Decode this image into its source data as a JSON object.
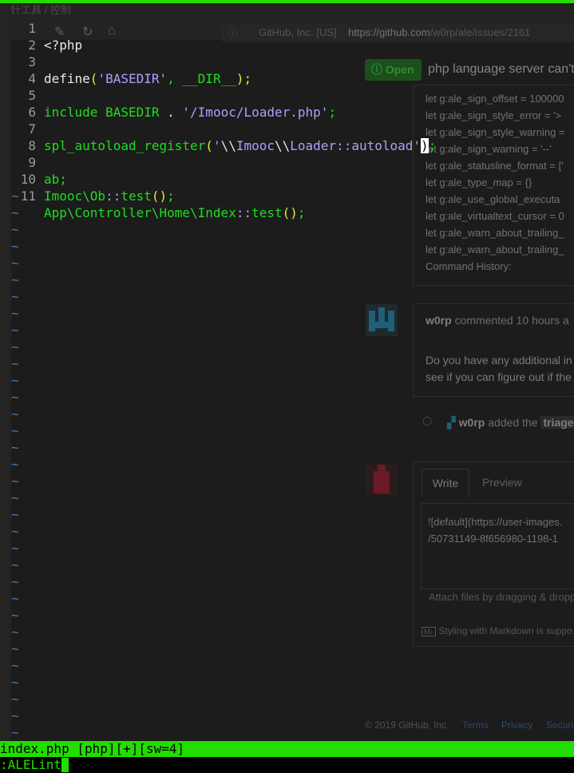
{
  "browser": {
    "tab_title": "指针工具 / 控制",
    "url_prefix": "GitHub, Inc. [US]",
    "url_host": "https://github.com",
    "url_path": "/w0rp/ale/issues/2161"
  },
  "issue": {
    "status": "Open",
    "title": "php language server can't",
    "config_lines": [
      "let g:ale_sign_offset = 100000",
      "let g:ale_sign_style_error = '>",
      "let g:ale_sign_style_warning =",
      "let g:ale_sign_warning = '--'",
      "let g:ale_statusline_format = ['",
      "let g:ale_type_map = {}",
      "let g:ale_use_global_executa",
      "let g:ale_virtualtext_cursor = 0",
      "let g:ale_warn_about_trailing_",
      "let g:ale_warn_about_trailing_",
      "Command History:"
    ],
    "comment_author": "w0rp",
    "comment_meta": "commented 10 hours a",
    "comment_lines": [
      "Do you have any additional in",
      "see if you can figure out if the"
    ],
    "label_author": "w0rp",
    "label_action": "added the",
    "label_name": "triage",
    "tab_write": "Write",
    "tab_preview": "Preview",
    "textarea_lines": [
      "![default](https://user-images.",
      "/50731149-8f656980-1198-1"
    ],
    "attach_hint": "Attach files by dragging & dropp",
    "markdown_hint": "Styling with Markdown is suppo",
    "footer_copyright": "© 2019 GitHub, Inc.",
    "footer_links": [
      "Terms",
      "Privacy",
      "Securi"
    ]
  },
  "editor": {
    "line_numbers": [
      "1",
      "2",
      "3",
      "4",
      "5",
      "6",
      "7",
      "8",
      "9",
      "10",
      "11"
    ],
    "lines": {
      "l1": "<?php",
      "l3_fn": "define",
      "l3_open": "(",
      "l3_str": "'BASEDIR'",
      "l3_comma": ", ",
      "l3_const": "__DIR__",
      "l3_close": ");",
      "l5_kw": "include",
      "l5_const": " BASEDIR",
      "l5_dot": " . ",
      "l5_str": "'/Imooc/Loader.php'",
      "l5_semi": ";",
      "l7_fn": "spl_autoload_register",
      "l7_open": "(",
      "l7_q1": "'",
      "l7_a": "\\\\",
      "l7_b": "Imooc",
      "l7_c": "\\\\",
      "l7_d": "Loader::autoload",
      "l7_q2": "'",
      "l7_close": ")",
      "l7_semi": ";",
      "l9": "ab;",
      "l10_ns": "Imooc\\Ob",
      "l10_op": "::",
      "l10_fn": "test",
      "l10_paren": "()",
      "l10_semi": ";",
      "l11_ns": "App\\Controller\\Home\\Index",
      "l11_op": "::",
      "l11_fn": "test",
      "l11_paren": "()",
      "l11_semi": ";"
    },
    "tilde": "~"
  },
  "statusline": "index.php [php][+][sw=4]",
  "cmdline": ":ALELint"
}
